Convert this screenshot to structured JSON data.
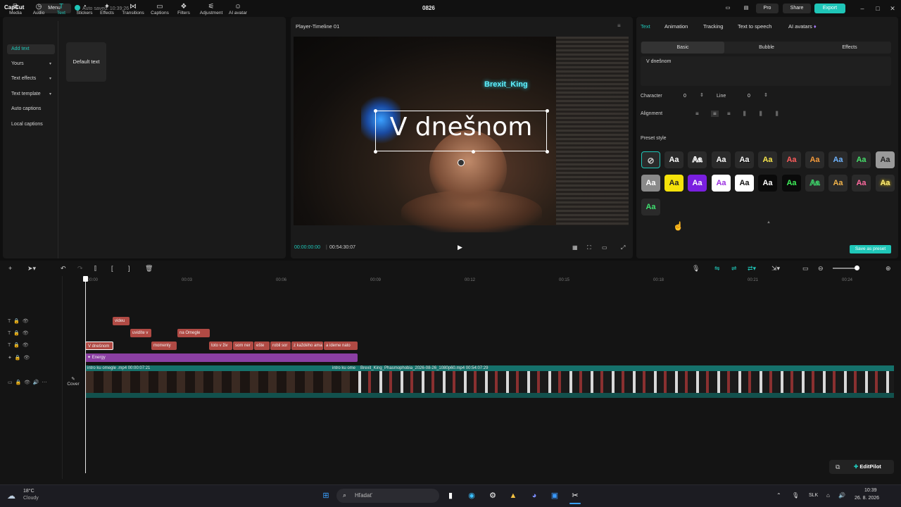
{
  "app": {
    "logo": "CapCut",
    "menu_label": "Menu",
    "autosave": "Auto saved: 10:39:26",
    "project_title": "0826",
    "pro_label": "Pro",
    "share_label": "Share",
    "export_label": "Export"
  },
  "toolbar": {
    "items": [
      "Media",
      "Audio",
      "Text",
      "Stickers",
      "Effects",
      "Transitions",
      "Captions",
      "Filters",
      "Adjustment",
      "AI avatar"
    ]
  },
  "sidebar": {
    "items": [
      "Add text",
      "Yours",
      "Text effects",
      "Text template",
      "Auto captions",
      "Local captions"
    ],
    "default_text": "Default text"
  },
  "player": {
    "title": "Player-Timeline 01",
    "overlay_text": "V dnešnom",
    "neon_sign": "Brexit_King",
    "current_time": "00:00:00:00",
    "total_time": "00:54:30:07"
  },
  "inspector": {
    "tabs": [
      "Text",
      "Animation",
      "Tracking",
      "Text to speech",
      "AI avatars"
    ],
    "subtabs": [
      "Basic",
      "Bubble",
      "Effects"
    ],
    "text_value": "V dnešnom",
    "character_label": "Character",
    "character_value": "0",
    "line_label": "Line",
    "line_value": "0",
    "alignment_label": "Alignment",
    "preset_label": "Preset style",
    "swatch_text": "Aa",
    "save_preset": "Save as preset"
  },
  "timeline": {
    "ruler": [
      "00:00",
      "00:03",
      "00:06",
      "00:09",
      "00:12",
      "00:15",
      "00:18",
      "00:21",
      "00:24"
    ],
    "clips_row1": [
      "videu"
    ],
    "clips_row2": [
      "uvidíte v",
      "na Omegle"
    ],
    "clips_row3": [
      "V dnešnom",
      "momenty",
      "toto v živ",
      "som ner",
      "ešte",
      "robil sor",
      "z každého ama",
      "a ideme nato"
    ],
    "effect_clip": "Energy",
    "video1_label": "intro ku omegle .mp4   00:00:07:21",
    "video1b_label": "intro ku ome",
    "video2_label": "Brexit_King_Phasmophobia_2026-08-26_1080p60.mp4   00:54:07:29",
    "cover_label": "Cover",
    "editpilot_label": "EditPilot"
  },
  "taskbar": {
    "weather_temp": "18°C",
    "weather_desc": "Cloudy",
    "search_placeholder": "Hľadať",
    "lang": "SLK",
    "time": "10:39",
    "date": "26. 8. 2026"
  },
  "colors": {
    "accent": "#1fc6b8",
    "clip_red": "#b04a44",
    "clip_purple": "#8b3fa3",
    "video_track": "#15716b"
  }
}
